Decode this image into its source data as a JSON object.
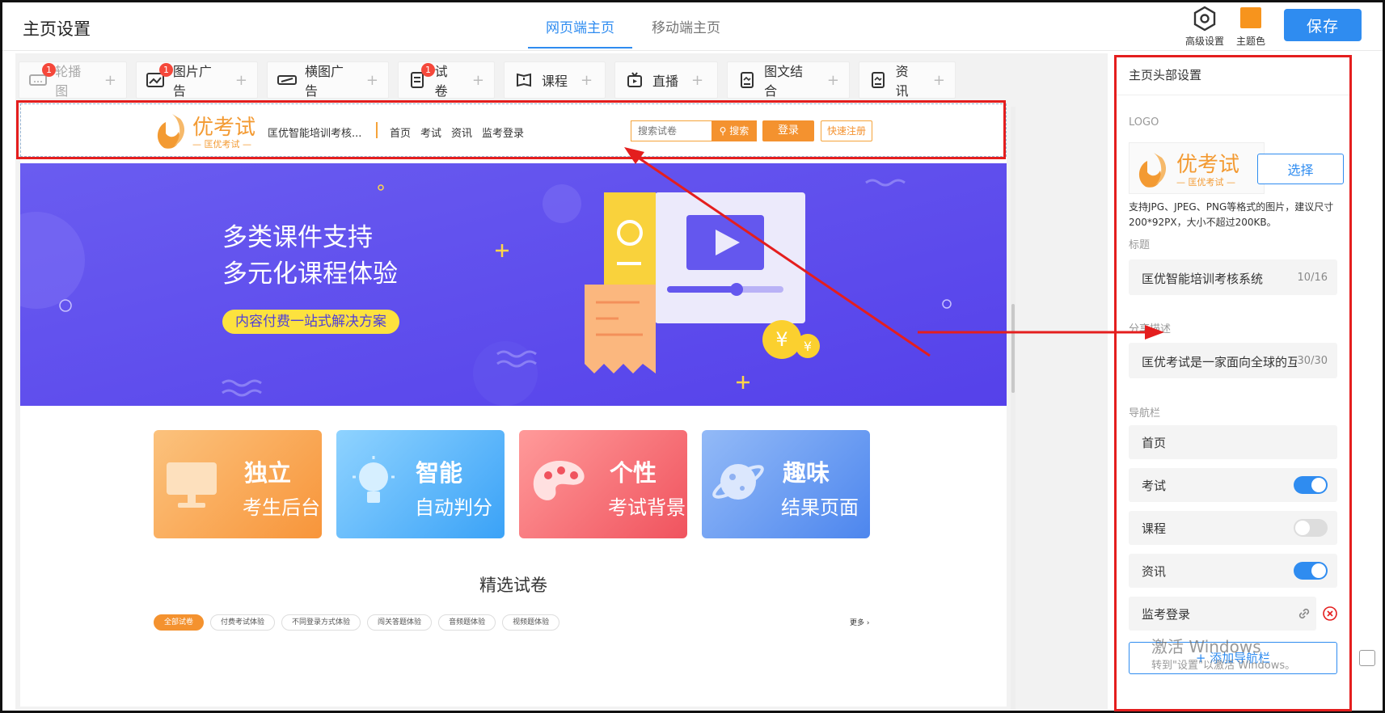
{
  "header": {
    "title": "主页设置",
    "tabs": [
      {
        "label": "网页端主页",
        "active": true
      },
      {
        "label": "移动端主页",
        "active": false
      }
    ],
    "advanced_label": "高级设置",
    "theme_label": "主题色",
    "theme_color": "#f7941d",
    "save_label": "保存",
    "accent": "#2f8cf0"
  },
  "toolbar": {
    "items": [
      {
        "label": "轮播图",
        "icon": "carousel-icon",
        "badge": "1",
        "dim": true
      },
      {
        "label": "图片广告",
        "icon": "image-ad-icon",
        "badge": "1"
      },
      {
        "label": "横图广告",
        "icon": "banner-ad-icon"
      },
      {
        "label": "试卷",
        "icon": "paper-icon",
        "badge": "1"
      },
      {
        "label": "课程",
        "icon": "book-icon"
      },
      {
        "label": "直播",
        "icon": "live-tv-icon"
      },
      {
        "label": "图文结合",
        "icon": "image-text-icon"
      },
      {
        "label": "资讯",
        "icon": "news-icon"
      }
    ],
    "plus": "+"
  },
  "preview": {
    "logo_text": "优考试",
    "logo_sub": "— 匡优考试 —",
    "site_name": "匡优智能培训考核...",
    "nav": [
      "首页",
      "考试",
      "资讯",
      "监考登录"
    ],
    "search_placeholder": "搜索试卷",
    "search_button": "搜索",
    "login": "登录",
    "register": "快速注册",
    "banner": {
      "line1": "多类课件支持",
      "line2": "多元化课程体验",
      "pill": "内容付费一站式解决方案"
    },
    "features": [
      {
        "title": "独立",
        "sub": "考生后台",
        "icon": "monitor-icon"
      },
      {
        "title": "智能",
        "sub": "自动判分",
        "icon": "lightbulb-icon"
      },
      {
        "title": "个性",
        "sub": "考试背景",
        "icon": "palette-icon"
      },
      {
        "title": "趣味",
        "sub": "结果页面",
        "icon": "planet-icon"
      }
    ],
    "section_title": "精选试卷",
    "filters": [
      "全部试卷",
      "付费考试体验",
      "不同登录方式体验",
      "闯关答题体验",
      "音频题体验",
      "视频题体验"
    ],
    "more": "更多 ›"
  },
  "panel": {
    "title": "主页头部设置",
    "logo_label": "LOGO",
    "choose_button": "选择",
    "logo_hint": "支持JPG、JPEG、PNG等格式的图片，建议尺寸200*92PX，大小不超过200KB。",
    "title_label": "标题",
    "title_value": "匡优智能培训考核系统",
    "title_count": "10/16",
    "share_label": "分享描述",
    "share_value": "匡优考试是一家面向全球的互联",
    "share_count": "30/30",
    "nav_label": "导航栏",
    "nav_items": [
      {
        "label": "首页",
        "toggle": null
      },
      {
        "label": "考试",
        "toggle": true
      },
      {
        "label": "课程",
        "toggle": false
      },
      {
        "label": "资讯",
        "toggle": true
      },
      {
        "label": "监考登录",
        "toggle": null
      }
    ],
    "add_nav": "+ 添加导航栏"
  },
  "watermark": {
    "line1": "激活 Windows",
    "line2": "转到\"设置\"以激活 Windows。"
  },
  "annotation_color": "#e41e1e"
}
